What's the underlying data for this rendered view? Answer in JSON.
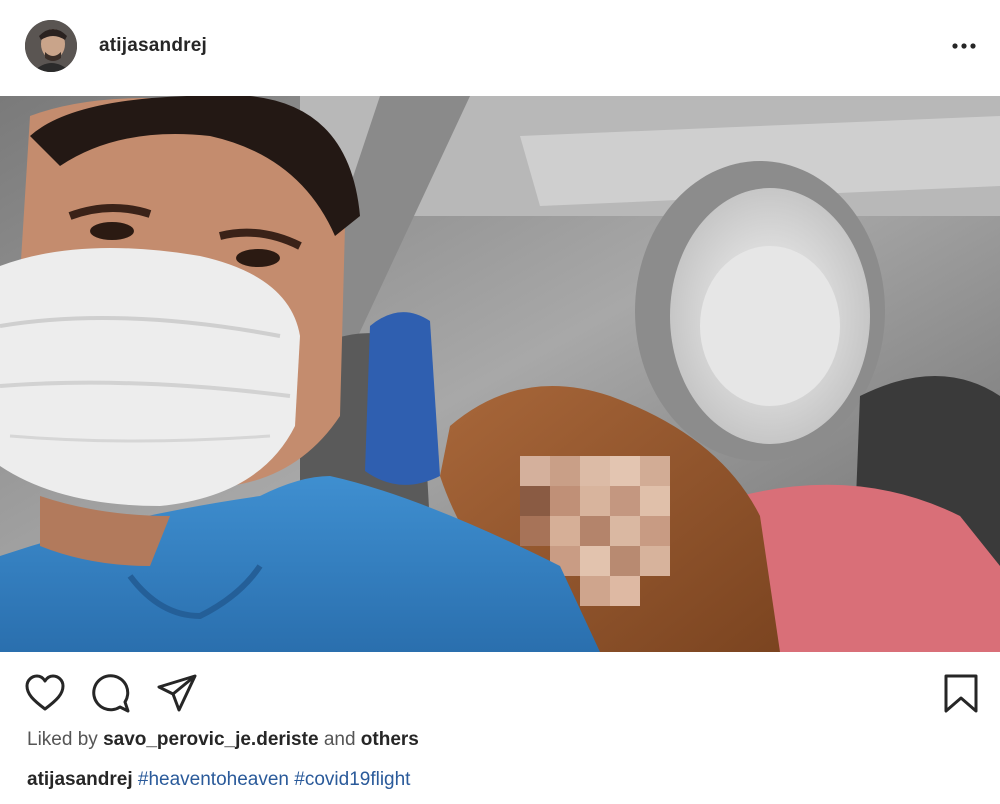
{
  "post": {
    "username": "atijasandrej",
    "avatar_icon": "user-avatar",
    "more_icon": "more-options-icon"
  },
  "actions": {
    "like_icon": "heart-icon",
    "comment_icon": "comment-icon",
    "share_icon": "send-icon",
    "save_icon": "bookmark-icon"
  },
  "likes": {
    "prefix": "Liked by",
    "user": "savo_perovic_je.deriste",
    "connector": "and",
    "others": "others"
  },
  "caption": {
    "username": "atijasandrej",
    "hashtags": [
      "#heaventoheaven",
      "#covid19flight"
    ]
  },
  "colors": {
    "hashtag": "#2a5a9a",
    "text": "#262626",
    "muted": "#555555"
  }
}
